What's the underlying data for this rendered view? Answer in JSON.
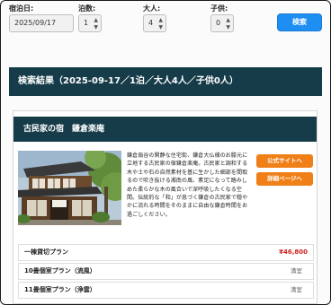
{
  "search": {
    "checkin_label": "宿泊日:",
    "checkin_value": "2025/09/17",
    "nights_label": "泊数:",
    "nights_value": "1",
    "adults_label": "大人:",
    "adults_value": "4",
    "children_label": "子供:",
    "children_value": "0",
    "search_button": "検索"
  },
  "results": {
    "header": "検索結果（2025-09-17／1泊／大人4人／子供0人）"
  },
  "inn": {
    "name": "古民家の宿　鎌倉楽庵",
    "description": "鎌倉扇谷の閑静な住宅街、鎌倉大仏様のお膝元に立地する古民家の宿鎌倉楽庵。古民家と調和する木や土や石の自然素材を基に生かした細部を間取るので吹き抜ける湘南の風、素足になって踏みしめた柔らかな木の風合いで深呼吸したくなる空間。伝統的な「和」が息づく鎌倉の古民家で穏やかに流れる時間をそのままに自由な鎌倉時間をお過ごしください。",
    "official_site_button": "公式サイトへ",
    "detail_button": "詳細ページへ",
    "photo_alt": "古民家外観",
    "plans": [
      {
        "name": "一棟貸切プラン",
        "price": "¥46,800",
        "status": ""
      },
      {
        "name": "10畳個室プラン（流風）",
        "price": "",
        "status": "満室"
      },
      {
        "name": "11畳個室プラン（浄雲）",
        "price": "",
        "status": "満室"
      }
    ]
  },
  "colors": {
    "header_bg": "#163c4a",
    "search_button": "#1e8ef2",
    "orange_button": "#f07f18",
    "price_red": "#d11f1f"
  }
}
